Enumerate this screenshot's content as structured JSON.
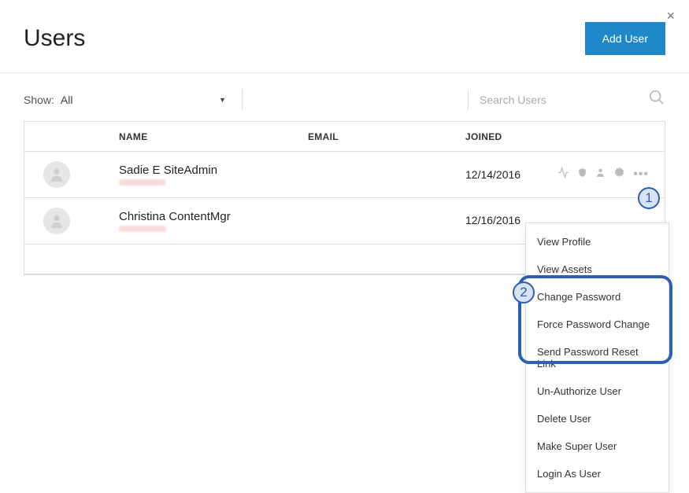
{
  "header": {
    "title": "Users",
    "add_btn": "Add User"
  },
  "filter": {
    "show_label": "Show:",
    "show_value": "All",
    "search_placeholder": "Search Users"
  },
  "table": {
    "columns": {
      "name": "NAME",
      "email": "EMAIL",
      "joined": "JOINED"
    },
    "rows": [
      {
        "name": "Sadie E SiteAdmin",
        "joined": "12/14/2016"
      },
      {
        "name": "Christina ContentMgr",
        "joined": "12/16/2016"
      }
    ]
  },
  "menu": {
    "items": [
      "View Profile",
      "View Assets",
      "Change Password",
      "Force Password Change",
      "Send Password Reset Link",
      "Un-Authorize User",
      "Delete User",
      "Make Super User",
      "Login As User"
    ]
  },
  "callouts": {
    "one": "1",
    "two": "2"
  }
}
